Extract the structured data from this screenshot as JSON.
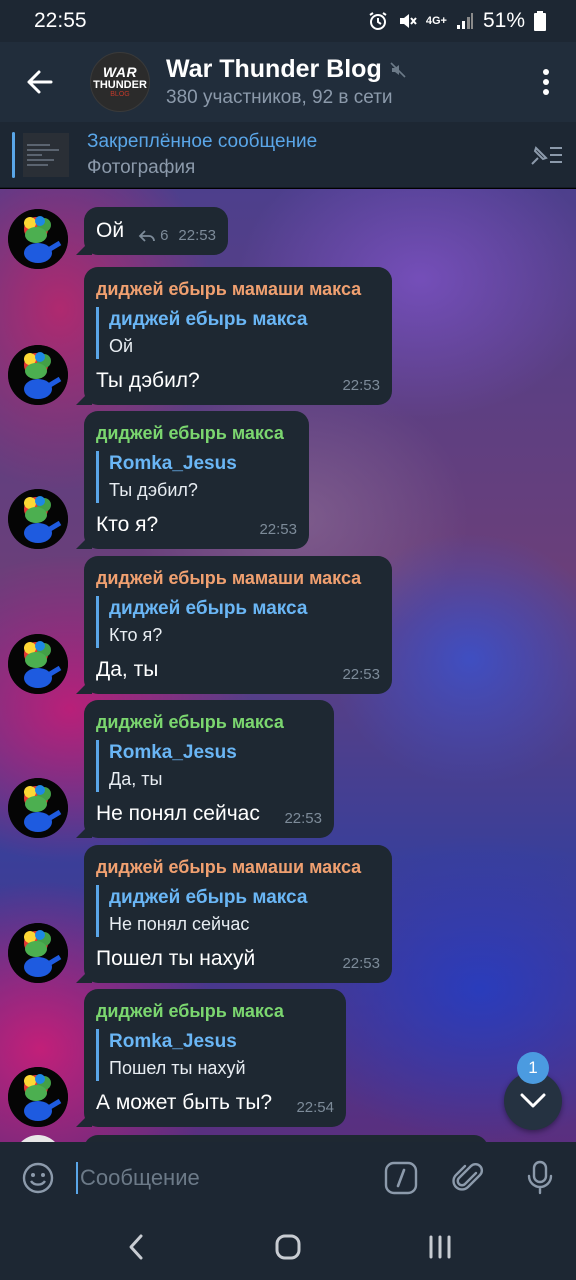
{
  "status_bar": {
    "time": "22:55",
    "network": "4G+",
    "battery": "51%"
  },
  "header": {
    "title": "War Thunder Blog",
    "subtitle": "380 участников, 92 в сети",
    "avatar_text": {
      "line1": "WAR",
      "line2": "THUNDER",
      "line3": "BLOG"
    }
  },
  "pinned": {
    "title": "Закреплённое сообщение",
    "subtitle": "Фотография"
  },
  "messages": [
    {
      "sender": "",
      "reply_name": "",
      "reply_text": "",
      "text": "Ой",
      "replies": "6",
      "time": "22:53"
    },
    {
      "sender": "диджей ебырь мамаши макса",
      "reply_name": "диджей ебырь макса",
      "reply_text": "Ой",
      "text": "Ты дэбил?",
      "time": "22:53"
    },
    {
      "sender": "диджей ебырь макса",
      "reply_name": "Romka_Jesus",
      "reply_text": "Ты дэбил?",
      "text": "Кто я?",
      "time": "22:53"
    },
    {
      "sender": "диджей ебырь мамаши макса",
      "reply_name": "диджей ебырь макса",
      "reply_text": "Кто я?",
      "text": "Да, ты",
      "time": "22:53"
    },
    {
      "sender": "диджей ебырь макса",
      "reply_name": "Romka_Jesus",
      "reply_text": "Да, ты",
      "text": "Не понял сейчас",
      "time": "22:53"
    },
    {
      "sender": "диджей ебырь мамаши макса",
      "reply_name": "диджей ебырь макса",
      "reply_text": "Не понял сейчас",
      "text": "Пошел ты нахуй",
      "time": "22:53"
    },
    {
      "sender": "диджей ебырь макса",
      "reply_name": "Romka_Jesus",
      "reply_text": "Пошел ты нахуй",
      "text": "А может быть ты?",
      "time": "22:54"
    }
  ],
  "scroll_down": {
    "unread_count": "1"
  },
  "composer": {
    "placeholder": "Сообщение"
  },
  "colors": {
    "accent": "#5aa6e8",
    "bubble": "#1e2832",
    "sender_orange": "#f0a070",
    "sender_green": "#7bd66f"
  }
}
